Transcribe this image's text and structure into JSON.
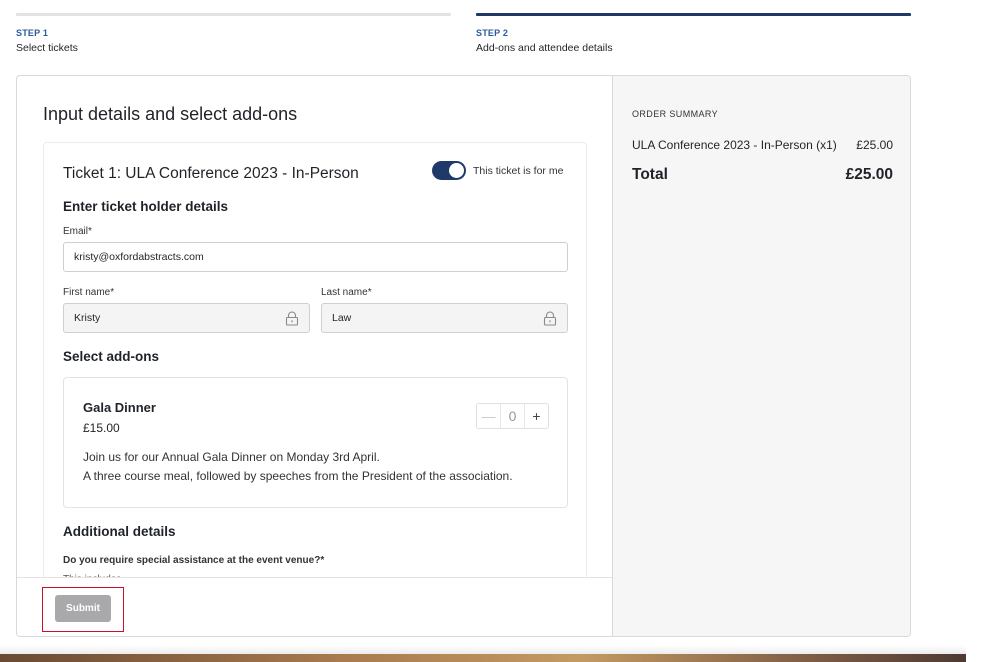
{
  "steps": [
    {
      "number": "STEP 1",
      "title": "Select tickets"
    },
    {
      "number": "STEP 2",
      "title": "Add-ons and attendee details"
    }
  ],
  "main": {
    "heading": "Input details and select add-ons",
    "ticket": {
      "title": "Ticket 1: ULA Conference 2023 - In-Person",
      "toggle_label": "This ticket is for me",
      "toggle_on": true,
      "holder_heading": "Enter ticket holder details",
      "email_label": "Email*",
      "email_value": "kristy@oxfordabstracts.com",
      "first_name_label": "First name*",
      "first_name_value": "Kristy",
      "last_name_label": "Last name*",
      "last_name_value": "Law",
      "addons_heading": "Select add-ons",
      "addon": {
        "name": "Gala Dinner",
        "price": "£15.00",
        "desc_line1": "Join us for our Annual Gala Dinner on Monday 3rd April.",
        "desc_line2": "A three course meal, followed by speeches from the President of the association.",
        "minus": "—",
        "quantity": "0",
        "plus": "+"
      },
      "additional_heading": "Additional details",
      "question": "Do you require special assistance at the event venue?*",
      "question_sub": "This includes"
    },
    "submit_label": "Submit"
  },
  "summary": {
    "heading": "ORDER SUMMARY",
    "item": "ULA Conference 2023 - In-Person (x1)",
    "item_price": "£25.00",
    "total_label": "Total",
    "total_value": "£25.00"
  },
  "colors": {
    "accent": "#1f3a68",
    "step_label": "#2c5aa0",
    "submit_disabled": "#a9a9ac",
    "highlight": "#c8102e"
  },
  "icons": {
    "lock": "lock-icon",
    "toggle": "toggle-switch"
  }
}
